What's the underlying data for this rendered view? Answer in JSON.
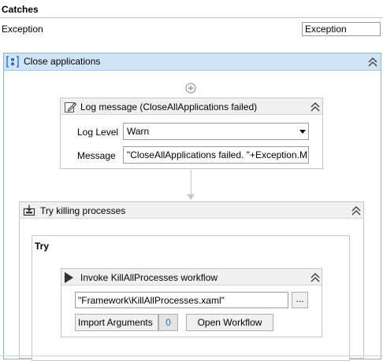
{
  "catches": {
    "title": "Catches",
    "exception_label": "Exception",
    "exception_type": "Exception"
  },
  "sequence": {
    "title": "Close applications",
    "icon": "sequence-icon",
    "add_icon": "plus-circle-icon"
  },
  "log_message": {
    "title": "Log message (CloseAllApplications failed)",
    "icon": "log-message-icon",
    "level_label": "Log Level",
    "level_value": "Warn",
    "message_label": "Message",
    "message_value": "\"CloseAllApplications failed. \"+Exception.M"
  },
  "try_catch": {
    "title": "Try killing processes",
    "icon": "try-catch-icon",
    "try_label": "Try"
  },
  "invoke": {
    "title": "Invoke KillAllProcesses workflow",
    "icon": "invoke-workflow-icon",
    "path_value": "\"Framework\\KillAllProcesses.xaml\"",
    "browse_label": "...",
    "import_label": "Import Arguments",
    "import_count": "0",
    "open_label": "Open Workflow"
  },
  "colors": {
    "sequence_header": "#cfe4f7",
    "activity_header": "#f0f0f0",
    "count_accent": "#1c6fbf"
  }
}
